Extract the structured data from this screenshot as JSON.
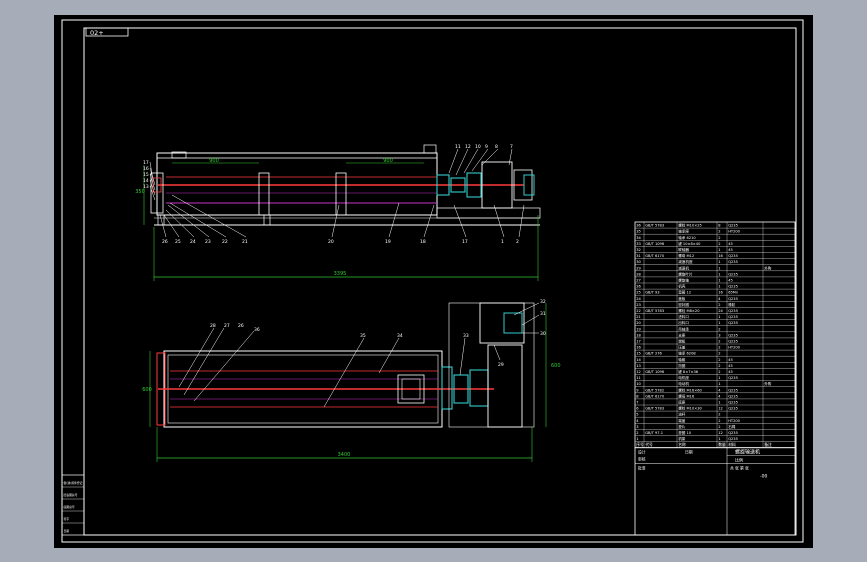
{
  "sheet": {
    "code_tag": "02+",
    "background": "#000000",
    "line_color": "#ffffff",
    "shaft_color": "#ff3b3b",
    "screw_color": "#cc33cc",
    "coupling_color": "#33cccc",
    "dimension_color": "#33cc33"
  },
  "front_view": {
    "dim_overall": "3395",
    "dim_left_segment": "900",
    "dim_right_segment": "900",
    "dim_height": "350",
    "top_callouts": [
      "11",
      "12",
      "10",
      "9",
      "8",
      "7"
    ],
    "left_callouts": [
      "17",
      "16",
      "15",
      "14",
      "13"
    ],
    "bottom_callouts": [
      "26",
      "25",
      "24",
      "23",
      "22",
      "21",
      "20",
      "19",
      "18",
      "17",
      "1",
      "2"
    ]
  },
  "top_view": {
    "dim_overall": "3400",
    "dim_width": "600",
    "dim_side": "600",
    "callouts": [
      "28",
      "27",
      "26",
      "36",
      "35",
      "34",
      "33",
      "32",
      "31",
      "30",
      "29"
    ]
  },
  "bom_table": {
    "rows": [
      [
        "36",
        "GB/T 5783",
        "螺栓 M10×25",
        "8",
        "Q235",
        ""
      ],
      [
        "35",
        "",
        "轴承座",
        "2",
        "HT200",
        ""
      ],
      [
        "34",
        "",
        "轴承 6210",
        "2",
        "",
        ""
      ],
      [
        "33",
        "GB/T 1096",
        "键 10×8×40",
        "2",
        "45",
        ""
      ],
      [
        "32",
        "",
        "联轴器",
        "1",
        "45",
        ""
      ],
      [
        "31",
        "GB/T 6170",
        "螺母 M12",
        "16",
        "Q235",
        ""
      ],
      [
        "30",
        "",
        "减速机座",
        "1",
        "Q235",
        ""
      ],
      [
        "29",
        "",
        "减速机",
        "1",
        "",
        "外购"
      ],
      [
        "28",
        "",
        "螺旋叶片",
        "1",
        "Q235",
        ""
      ],
      [
        "27",
        "",
        "螺旋轴",
        "1",
        "45",
        ""
      ],
      [
        "26",
        "",
        "机壳",
        "1",
        "Q235",
        ""
      ],
      [
        "25",
        "GB/T 93",
        "垫圈 12",
        "16",
        "65Mn",
        ""
      ],
      [
        "24",
        "",
        "盖板",
        "4",
        "Q235",
        ""
      ],
      [
        "23",
        "",
        "密封圈",
        "2",
        "橡胶",
        ""
      ],
      [
        "22",
        "GB/T 5783",
        "螺栓 M8×20",
        "24",
        "Q235",
        ""
      ],
      [
        "21",
        "",
        "进料口",
        "1",
        "Q235",
        ""
      ],
      [
        "20",
        "",
        "出料口",
        "1",
        "Q235",
        ""
      ],
      [
        "19",
        "",
        "吊轴承",
        "2",
        "",
        ""
      ],
      [
        "18",
        "",
        "支座",
        "3",
        "Q235",
        ""
      ],
      [
        "17",
        "",
        "端板",
        "2",
        "Q235",
        ""
      ],
      [
        "16",
        "",
        "压盖",
        "2",
        "HT200",
        ""
      ],
      [
        "15",
        "GB/T 276",
        "轴承 6208",
        "2",
        "",
        ""
      ],
      [
        "14",
        "",
        "轴套",
        "2",
        "45",
        ""
      ],
      [
        "13",
        "",
        "挡圈",
        "2",
        "45",
        ""
      ],
      [
        "12",
        "GB/T 1096",
        "键 8×7×36",
        "2",
        "45",
        ""
      ],
      [
        "11",
        "",
        "电机座",
        "1",
        "Q235",
        ""
      ],
      [
        "10",
        "",
        "电动机",
        "1",
        "",
        "外购"
      ],
      [
        "9",
        "GB/T 5782",
        "螺栓 M16×60",
        "4",
        "Q235",
        ""
      ],
      [
        "8",
        "GB/T 6170",
        "螺母 M16",
        "4",
        "Q235",
        ""
      ],
      [
        "7",
        "",
        "底座",
        "1",
        "Q235",
        ""
      ],
      [
        "6",
        "GB/T 5783",
        "螺栓 M10×30",
        "12",
        "Q235",
        ""
      ],
      [
        "5",
        "",
        "油杯",
        "2",
        "",
        ""
      ],
      [
        "4",
        "",
        "端盖",
        "2",
        "HT200",
        ""
      ],
      [
        "3",
        "",
        "垫片",
        "2",
        "石棉",
        ""
      ],
      [
        "2",
        "GB/T 97.1",
        "垫圈 10",
        "12",
        "Q235",
        ""
      ],
      [
        "1",
        "",
        "机架",
        "1",
        "Q235",
        ""
      ]
    ],
    "header": [
      "序号",
      "代号",
      "名称",
      "数量",
      "材料",
      "备注"
    ],
    "title_block": {
      "drawing_title": "螺旋输送机",
      "scale_label": "比例",
      "sheet_label": "共 张 第 张",
      "drawing_no": "-00",
      "designer_label": "设计",
      "checker_label": "审核",
      "approver_label": "批准",
      "date_label": "日期"
    }
  },
  "revision_block": {
    "rows": [
      "借(通)用件登记",
      "旧底图总号",
      "底图总号",
      "签字",
      "日期"
    ]
  }
}
